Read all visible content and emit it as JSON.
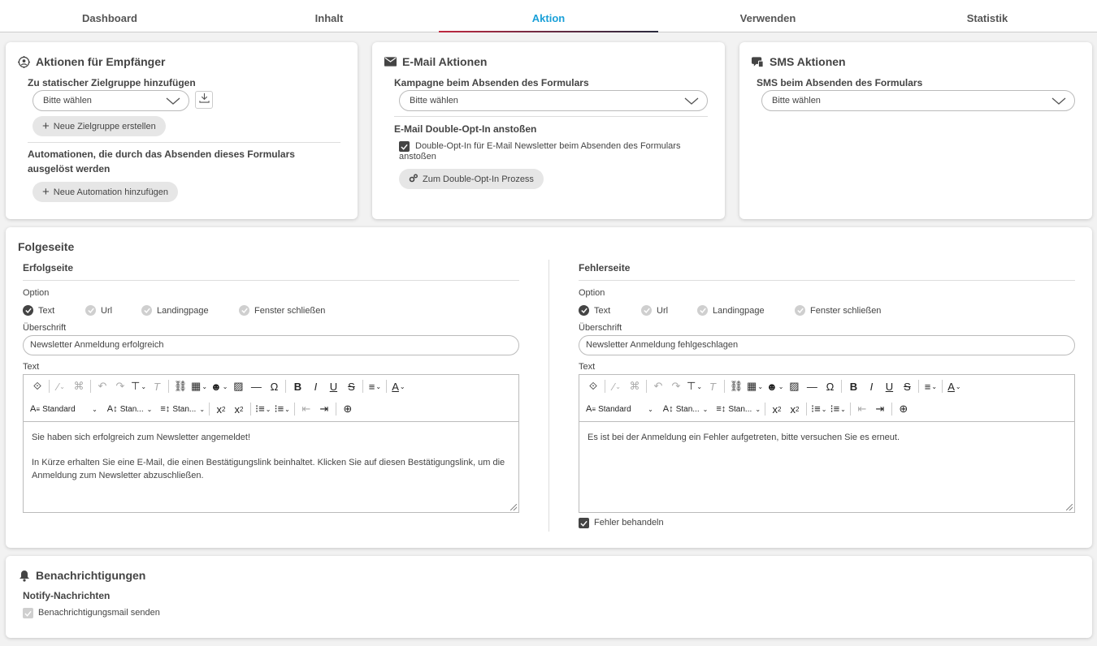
{
  "tabs": [
    "Dashboard",
    "Inhalt",
    "Aktion",
    "Verwenden",
    "Statistik"
  ],
  "recipients": {
    "title": "Aktionen für Empfänger",
    "group_label": "Zu statischer Zielgruppe hinzufügen",
    "group_select": "Bitte wählen",
    "new_group": "Neue Zielgruppe erstellen",
    "automation_label": "Automationen, die durch das Absenden dieses Formulars ausgelöst werden",
    "new_automation": "Neue Automation hinzufügen"
  },
  "email": {
    "title": "E-Mail Aktionen",
    "campaign_label": "Kampagne beim Absenden des Formulars",
    "campaign_select": "Bitte wählen",
    "doi_label": "E-Mail Double-Opt-In anstoßen",
    "doi_check": "Double-Opt-In für E-Mail Newsletter beim Absenden des Formulars anstoßen",
    "doi_button": "Zum Double-Opt-In Prozess"
  },
  "sms": {
    "title": "SMS Aktionen",
    "sms_label": "SMS beim Absenden des Formulars",
    "sms_select": "Bitte wählen"
  },
  "followup": {
    "title": "Folgeseite",
    "success": {
      "title": "Erfolgseite",
      "option_label": "Option",
      "options": [
        "Text",
        "Url",
        "Landingpage",
        "Fenster schließen"
      ],
      "heading_label": "Überschrift",
      "heading_value": "Newsletter Anmeldung erfolgreich",
      "text_label": "Text",
      "content_p1": "Sie haben sich erfolgreich zum Newsletter angemeldet!",
      "content_p2": "In Kürze erhalten Sie eine E-Mail, die einen Bestätigungslink beinhaltet. Klicken Sie auf diesen Bestätigungslink, um die Anmeldung zum Newsletter abzuschließen."
    },
    "error": {
      "title": "Fehlerseite",
      "option_label": "Option",
      "options": [
        "Text",
        "Url",
        "Landingpage",
        "Fenster schließen"
      ],
      "heading_label": "Überschrift",
      "heading_value": "Newsletter Anmeldung fehlgeschlagen",
      "text_label": "Text",
      "content_p1": "Es ist bei der Anmeldung ein Fehler aufgetreten, bitte versuchen Sie es erneut.",
      "handle_errors": "Fehler behandeln"
    },
    "toolbar": {
      "style": "Standard",
      "size": "Stan...",
      "height": "Stan..."
    }
  },
  "notifications": {
    "title": "Benachrichtigungen",
    "sub": "Notify-Nachrichten",
    "check": "Benachrichtigungsmail senden"
  }
}
